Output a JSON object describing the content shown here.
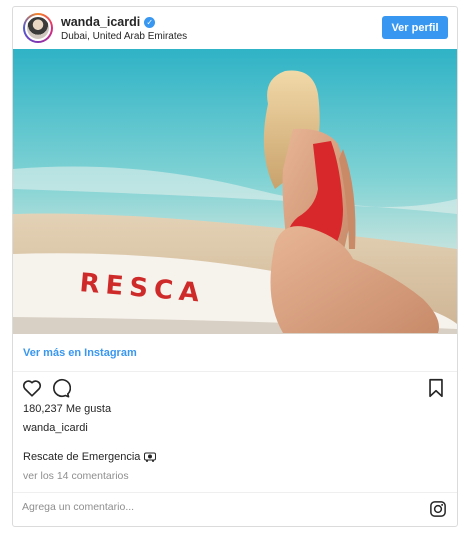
{
  "header": {
    "username": "wanda_icardi",
    "location": "Dubai, United Arab Emirates",
    "view_profile_label": "Ver perfil",
    "verified_icon": "verified-check-icon"
  },
  "photo": {
    "board_text": "RESCA"
  },
  "more_link_label": "Ver más en Instagram",
  "actions": {
    "like_icon": "heart-icon",
    "comment_icon": "comment-icon",
    "save_icon": "bookmark-icon"
  },
  "likes_text": "180,237 Me gusta",
  "caption_username": "wanda_icardi",
  "caption_text": "Rescate de Emergencia",
  "comments_link": "ver los 14 comentarios",
  "comment_placeholder": "Agrega un comentario...",
  "colors": {
    "accent": "#3897f0",
    "text": "#262626",
    "muted": "#8e8e8e",
    "border": "#dbdbdb"
  }
}
